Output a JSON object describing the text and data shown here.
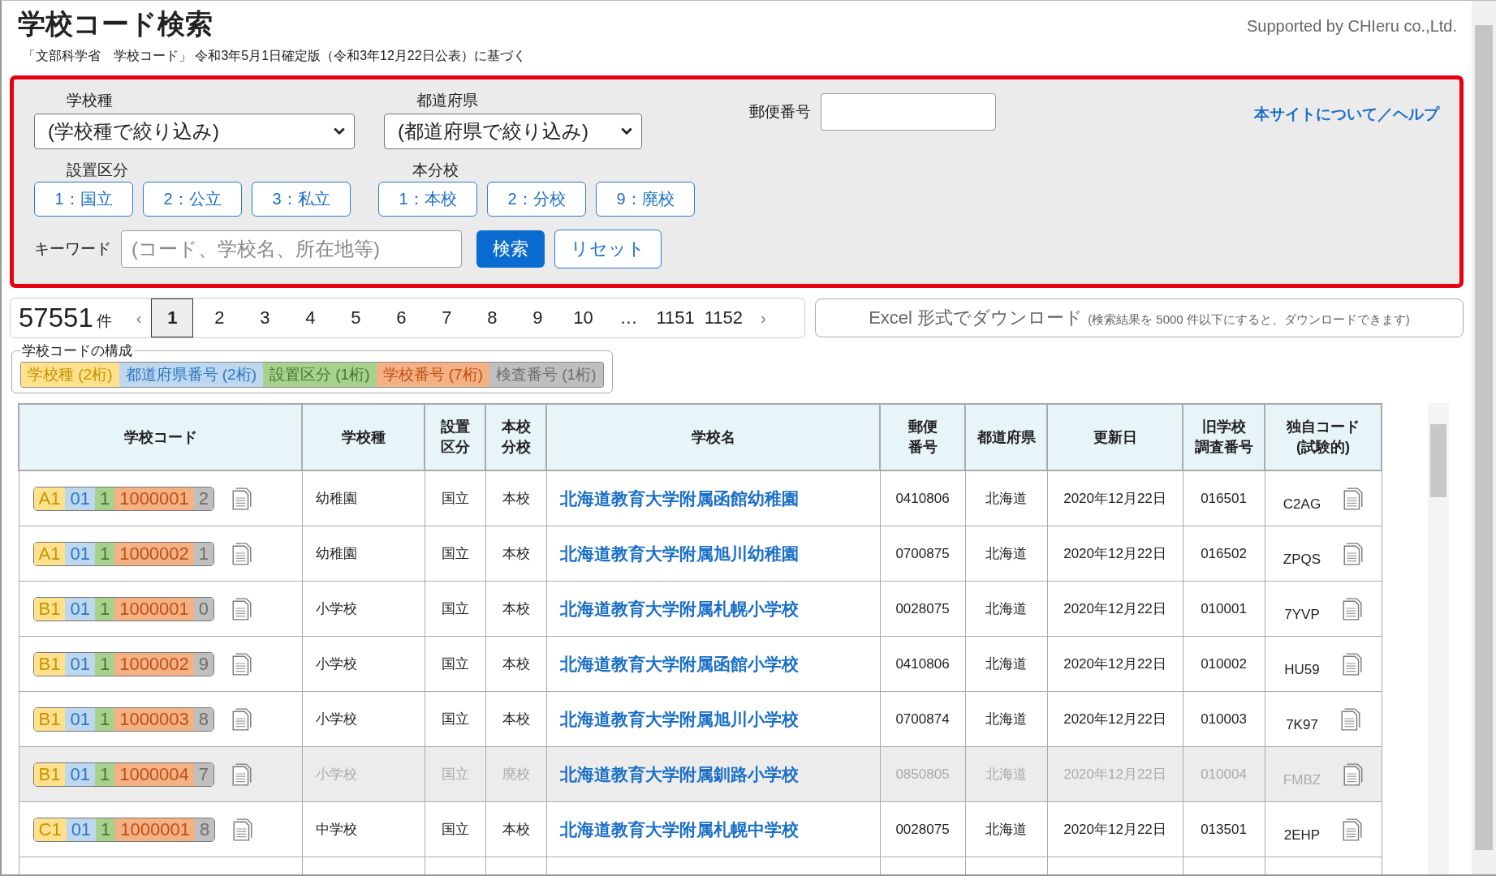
{
  "header": {
    "title": "学校コード検索",
    "subtitle": "「文部科学省　学校コード」 令和3年5月1日確定版（令和3年12月22日公表）に基づく",
    "credit": "Supported by CHIeru co.,Ltd."
  },
  "filters": {
    "school_type": {
      "label": "学校種",
      "value": "(学校種で絞り込み)"
    },
    "prefecture": {
      "label": "都道府県",
      "value": "(都道府県で絞り込み)"
    },
    "postal": {
      "label": "郵便番号"
    },
    "help_link": "本サイトについて／ヘルプ",
    "establishment": {
      "label": "設置区分",
      "options": [
        {
          "label": "1：国立",
          "selected": false
        },
        {
          "label": "2：公立",
          "selected": false
        },
        {
          "label": "3：私立",
          "selected": false
        }
      ]
    },
    "branch": {
      "label": "本分校",
      "options": [
        {
          "label": "1：本校",
          "selected": false
        },
        {
          "label": "2：分校",
          "selected": false
        },
        {
          "label": "9：廃校",
          "selected": false
        }
      ]
    },
    "keyword": {
      "label": "キーワード",
      "placeholder": "(コード、学校名、所在地等)"
    },
    "search_button": "検索",
    "reset_button": "リセット"
  },
  "pagination": {
    "count": "57551",
    "unit": "件",
    "prev": "‹",
    "next": "›",
    "pages": [
      {
        "label": "1",
        "selected": true
      },
      {
        "label": "2",
        "selected": false
      },
      {
        "label": "3",
        "selected": false
      },
      {
        "label": "4",
        "selected": false
      },
      {
        "label": "5",
        "selected": false
      },
      {
        "label": "6",
        "selected": false
      },
      {
        "label": "7",
        "selected": false
      },
      {
        "label": "8",
        "selected": false
      },
      {
        "label": "9",
        "selected": false
      },
      {
        "label": "10",
        "selected": false
      },
      {
        "label": "…",
        "selected": false
      },
      {
        "label": "1151",
        "selected": false
      },
      {
        "label": "1152",
        "selected": false
      }
    ]
  },
  "excel_button": {
    "label": "Excel 形式でダウンロード",
    "note": "(検索結果を 5000 件以下にすると、ダウンロードできます)"
  },
  "code_legend": {
    "title": "学校コードの構成",
    "items": [
      {
        "label": "学校種 (2桁)",
        "color": "#ffe08c"
      },
      {
        "label": "都道府県番号 (2桁)",
        "color": "#bdd7ee"
      },
      {
        "label": "設置区分 (1桁)",
        "color": "#a9d18e"
      },
      {
        "label": "学校番号 (7桁)",
        "color": "#f4b183"
      },
      {
        "label": "検査番号 (1桁)",
        "color": "#bfbfbf"
      }
    ]
  },
  "table": {
    "columns": [
      "学校コード",
      "学校種",
      "設置区分",
      "本校分校",
      "学校名",
      "郵便番号",
      "都道府県",
      "更新日",
      "旧学校調査番号",
      "独自コード(試験的)"
    ],
    "rows": [
      {
        "code": [
          "A1",
          "01",
          "1",
          "1000001",
          "2"
        ],
        "type": "幼稚園",
        "est": "国立",
        "branch": "本校",
        "name": "北海道教育大学附属函館幼稚園",
        "postal": "0410806",
        "pref": "北海道",
        "updated": "2020年12月22日",
        "old_no": "016501",
        "own_code": "C2AG",
        "closed": false
      },
      {
        "code": [
          "A1",
          "01",
          "1",
          "1000002",
          "1"
        ],
        "type": "幼稚園",
        "est": "国立",
        "branch": "本校",
        "name": "北海道教育大学附属旭川幼稚園",
        "postal": "0700875",
        "pref": "北海道",
        "updated": "2020年12月22日",
        "old_no": "016502",
        "own_code": "ZPQS",
        "closed": false
      },
      {
        "code": [
          "B1",
          "01",
          "1",
          "1000001",
          "0"
        ],
        "type": "小学校",
        "est": "国立",
        "branch": "本校",
        "name": "北海道教育大学附属札幌小学校",
        "postal": "0028075",
        "pref": "北海道",
        "updated": "2020年12月22日",
        "old_no": "010001",
        "own_code": "7YVP",
        "closed": false
      },
      {
        "code": [
          "B1",
          "01",
          "1",
          "1000002",
          "9"
        ],
        "type": "小学校",
        "est": "国立",
        "branch": "本校",
        "name": "北海道教育大学附属函館小学校",
        "postal": "0410806",
        "pref": "北海道",
        "updated": "2020年12月22日",
        "old_no": "010002",
        "own_code": "HU59",
        "closed": false
      },
      {
        "code": [
          "B1",
          "01",
          "1",
          "1000003",
          "8"
        ],
        "type": "小学校",
        "est": "国立",
        "branch": "本校",
        "name": "北海道教育大学附属旭川小学校",
        "postal": "0700874",
        "pref": "北海道",
        "updated": "2020年12月22日",
        "old_no": "010003",
        "own_code": "7K97",
        "closed": false
      },
      {
        "code": [
          "B1",
          "01",
          "1",
          "1000004",
          "7"
        ],
        "type": "小学校",
        "est": "国立",
        "branch": "廃校",
        "name": "北海道教育大学附属釧路小学校",
        "postal": "0850805",
        "pref": "北海道",
        "updated": "2020年12月22日",
        "old_no": "010004",
        "own_code": "FMBZ",
        "closed": true
      },
      {
        "code": [
          "C1",
          "01",
          "1",
          "1000001",
          "8"
        ],
        "type": "中学校",
        "est": "国立",
        "branch": "本校",
        "name": "北海道教育大学附属札幌中学校",
        "postal": "0028075",
        "pref": "北海道",
        "updated": "2020年12月22日",
        "old_no": "013501",
        "own_code": "2EHP",
        "closed": false
      }
    ]
  }
}
